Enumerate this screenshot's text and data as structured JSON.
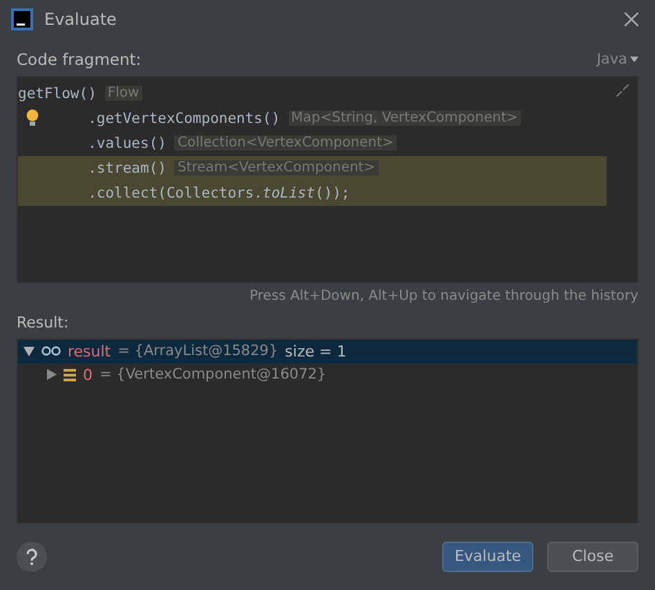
{
  "window": {
    "title": "Evaluate"
  },
  "code_label": "Code fragment:",
  "language": "Java",
  "code_lines": [
    {
      "code": "getFlow()",
      "hint": "Flow",
      "highlighted": false,
      "bulb": false
    },
    {
      "code": "        .getVertexComponents()",
      "hint": "Map<String, VertexComponent>",
      "highlighted": false,
      "bulb": true
    },
    {
      "code": "        .values()",
      "hint": "Collection<VertexComponent>",
      "highlighted": false,
      "bulb": false
    },
    {
      "code": "        .stream()",
      "hint": "Stream<VertexComponent>",
      "highlighted": true,
      "bulb": false
    },
    {
      "code": "        .collect(Collectors.*toList*());",
      "highlighted": true,
      "bulb": false
    }
  ],
  "history_hint": "Press Alt+Down, Alt+Up to navigate through the history",
  "result_label": "Result:",
  "tree": [
    {
      "name": "result",
      "value": "= {ArrayList@15829}",
      "extra": "size = 1",
      "selected": true,
      "expanded": true,
      "kind": "watch",
      "children": [
        {
          "name": "0",
          "value": "= {VertexComponent@16072}",
          "selected": false,
          "expanded": false,
          "kind": "field"
        }
      ]
    }
  ],
  "buttons": [
    {
      "label": "Evaluate",
      "kind": "primary"
    },
    {
      "label": "Close",
      "kind": "secondary"
    }
  ]
}
